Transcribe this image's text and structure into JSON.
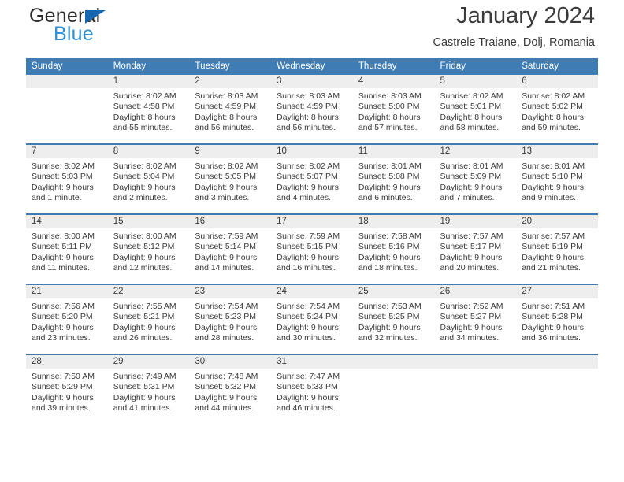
{
  "brand": {
    "name_part1": "General",
    "name_part2": "Blue",
    "triangle_icon": "triangle-icon",
    "accent_color": "#1667b2",
    "blue_text_color": "#2f8fd4"
  },
  "header": {
    "title": "January 2024",
    "subtitle": "Castrele Traiane, Dolj, Romania"
  },
  "theme": {
    "header_row_bg": "#3f7cb4",
    "day_band_bg": "#eeeeee",
    "row_separator": "#3f7cb4",
    "text": "#3b3b3b"
  },
  "calendar": {
    "weekday_headers": [
      "Sunday",
      "Monday",
      "Tuesday",
      "Wednesday",
      "Thursday",
      "Friday",
      "Saturday"
    ],
    "weeks": [
      [
        {
          "day": "",
          "sunrise": "",
          "sunset": "",
          "daylight_line1": "",
          "daylight_line2": ""
        },
        {
          "day": "1",
          "sunrise": "Sunrise: 8:02 AM",
          "sunset": "Sunset: 4:58 PM",
          "daylight_line1": "Daylight: 8 hours",
          "daylight_line2": "and 55 minutes."
        },
        {
          "day": "2",
          "sunrise": "Sunrise: 8:03 AM",
          "sunset": "Sunset: 4:59 PM",
          "daylight_line1": "Daylight: 8 hours",
          "daylight_line2": "and 56 minutes."
        },
        {
          "day": "3",
          "sunrise": "Sunrise: 8:03 AM",
          "sunset": "Sunset: 4:59 PM",
          "daylight_line1": "Daylight: 8 hours",
          "daylight_line2": "and 56 minutes."
        },
        {
          "day": "4",
          "sunrise": "Sunrise: 8:03 AM",
          "sunset": "Sunset: 5:00 PM",
          "daylight_line1": "Daylight: 8 hours",
          "daylight_line2": "and 57 minutes."
        },
        {
          "day": "5",
          "sunrise": "Sunrise: 8:02 AM",
          "sunset": "Sunset: 5:01 PM",
          "daylight_line1": "Daylight: 8 hours",
          "daylight_line2": "and 58 minutes."
        },
        {
          "day": "6",
          "sunrise": "Sunrise: 8:02 AM",
          "sunset": "Sunset: 5:02 PM",
          "daylight_line1": "Daylight: 8 hours",
          "daylight_line2": "and 59 minutes."
        }
      ],
      [
        {
          "day": "7",
          "sunrise": "Sunrise: 8:02 AM",
          "sunset": "Sunset: 5:03 PM",
          "daylight_line1": "Daylight: 9 hours",
          "daylight_line2": "and 1 minute."
        },
        {
          "day": "8",
          "sunrise": "Sunrise: 8:02 AM",
          "sunset": "Sunset: 5:04 PM",
          "daylight_line1": "Daylight: 9 hours",
          "daylight_line2": "and 2 minutes."
        },
        {
          "day": "9",
          "sunrise": "Sunrise: 8:02 AM",
          "sunset": "Sunset: 5:05 PM",
          "daylight_line1": "Daylight: 9 hours",
          "daylight_line2": "and 3 minutes."
        },
        {
          "day": "10",
          "sunrise": "Sunrise: 8:02 AM",
          "sunset": "Sunset: 5:07 PM",
          "daylight_line1": "Daylight: 9 hours",
          "daylight_line2": "and 4 minutes."
        },
        {
          "day": "11",
          "sunrise": "Sunrise: 8:01 AM",
          "sunset": "Sunset: 5:08 PM",
          "daylight_line1": "Daylight: 9 hours",
          "daylight_line2": "and 6 minutes."
        },
        {
          "day": "12",
          "sunrise": "Sunrise: 8:01 AM",
          "sunset": "Sunset: 5:09 PM",
          "daylight_line1": "Daylight: 9 hours",
          "daylight_line2": "and 7 minutes."
        },
        {
          "day": "13",
          "sunrise": "Sunrise: 8:01 AM",
          "sunset": "Sunset: 5:10 PM",
          "daylight_line1": "Daylight: 9 hours",
          "daylight_line2": "and 9 minutes."
        }
      ],
      [
        {
          "day": "14",
          "sunrise": "Sunrise: 8:00 AM",
          "sunset": "Sunset: 5:11 PM",
          "daylight_line1": "Daylight: 9 hours",
          "daylight_line2": "and 11 minutes."
        },
        {
          "day": "15",
          "sunrise": "Sunrise: 8:00 AM",
          "sunset": "Sunset: 5:12 PM",
          "daylight_line1": "Daylight: 9 hours",
          "daylight_line2": "and 12 minutes."
        },
        {
          "day": "16",
          "sunrise": "Sunrise: 7:59 AM",
          "sunset": "Sunset: 5:14 PM",
          "daylight_line1": "Daylight: 9 hours",
          "daylight_line2": "and 14 minutes."
        },
        {
          "day": "17",
          "sunrise": "Sunrise: 7:59 AM",
          "sunset": "Sunset: 5:15 PM",
          "daylight_line1": "Daylight: 9 hours",
          "daylight_line2": "and 16 minutes."
        },
        {
          "day": "18",
          "sunrise": "Sunrise: 7:58 AM",
          "sunset": "Sunset: 5:16 PM",
          "daylight_line1": "Daylight: 9 hours",
          "daylight_line2": "and 18 minutes."
        },
        {
          "day": "19",
          "sunrise": "Sunrise: 7:57 AM",
          "sunset": "Sunset: 5:17 PM",
          "daylight_line1": "Daylight: 9 hours",
          "daylight_line2": "and 20 minutes."
        },
        {
          "day": "20",
          "sunrise": "Sunrise: 7:57 AM",
          "sunset": "Sunset: 5:19 PM",
          "daylight_line1": "Daylight: 9 hours",
          "daylight_line2": "and 21 minutes."
        }
      ],
      [
        {
          "day": "21",
          "sunrise": "Sunrise: 7:56 AM",
          "sunset": "Sunset: 5:20 PM",
          "daylight_line1": "Daylight: 9 hours",
          "daylight_line2": "and 23 minutes."
        },
        {
          "day": "22",
          "sunrise": "Sunrise: 7:55 AM",
          "sunset": "Sunset: 5:21 PM",
          "daylight_line1": "Daylight: 9 hours",
          "daylight_line2": "and 26 minutes."
        },
        {
          "day": "23",
          "sunrise": "Sunrise: 7:54 AM",
          "sunset": "Sunset: 5:23 PM",
          "daylight_line1": "Daylight: 9 hours",
          "daylight_line2": "and 28 minutes."
        },
        {
          "day": "24",
          "sunrise": "Sunrise: 7:54 AM",
          "sunset": "Sunset: 5:24 PM",
          "daylight_line1": "Daylight: 9 hours",
          "daylight_line2": "and 30 minutes."
        },
        {
          "day": "25",
          "sunrise": "Sunrise: 7:53 AM",
          "sunset": "Sunset: 5:25 PM",
          "daylight_line1": "Daylight: 9 hours",
          "daylight_line2": "and 32 minutes."
        },
        {
          "day": "26",
          "sunrise": "Sunrise: 7:52 AM",
          "sunset": "Sunset: 5:27 PM",
          "daylight_line1": "Daylight: 9 hours",
          "daylight_line2": "and 34 minutes."
        },
        {
          "day": "27",
          "sunrise": "Sunrise: 7:51 AM",
          "sunset": "Sunset: 5:28 PM",
          "daylight_line1": "Daylight: 9 hours",
          "daylight_line2": "and 36 minutes."
        }
      ],
      [
        {
          "day": "28",
          "sunrise": "Sunrise: 7:50 AM",
          "sunset": "Sunset: 5:29 PM",
          "daylight_line1": "Daylight: 9 hours",
          "daylight_line2": "and 39 minutes."
        },
        {
          "day": "29",
          "sunrise": "Sunrise: 7:49 AM",
          "sunset": "Sunset: 5:31 PM",
          "daylight_line1": "Daylight: 9 hours",
          "daylight_line2": "and 41 minutes."
        },
        {
          "day": "30",
          "sunrise": "Sunrise: 7:48 AM",
          "sunset": "Sunset: 5:32 PM",
          "daylight_line1": "Daylight: 9 hours",
          "daylight_line2": "and 44 minutes."
        },
        {
          "day": "31",
          "sunrise": "Sunrise: 7:47 AM",
          "sunset": "Sunset: 5:33 PM",
          "daylight_line1": "Daylight: 9 hours",
          "daylight_line2": "and 46 minutes."
        },
        {
          "day": "",
          "sunrise": "",
          "sunset": "",
          "daylight_line1": "",
          "daylight_line2": ""
        },
        {
          "day": "",
          "sunrise": "",
          "sunset": "",
          "daylight_line1": "",
          "daylight_line2": ""
        },
        {
          "day": "",
          "sunrise": "",
          "sunset": "",
          "daylight_line1": "",
          "daylight_line2": ""
        }
      ]
    ]
  }
}
